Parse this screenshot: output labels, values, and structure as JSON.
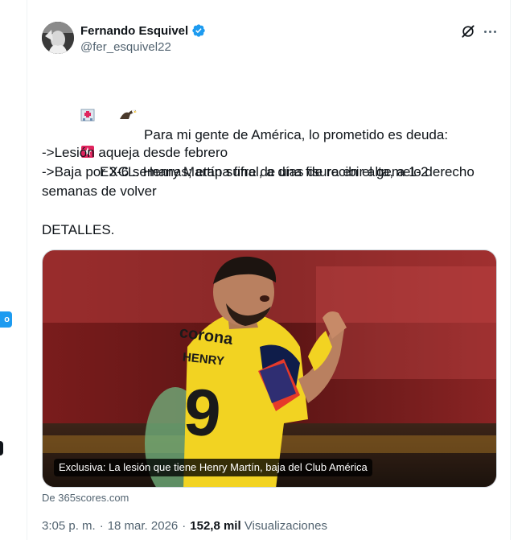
{
  "author": {
    "display_name": "Fernando Esquivel",
    "handle": "@fer_esquivel22",
    "verified": true
  },
  "colors": {
    "accent": "#1d9bf0",
    "text": "#0f1419",
    "secondary": "#536471",
    "jersey_yellow": "#f2d322"
  },
  "edge": {
    "badge_text": "o"
  },
  "tweet": {
    "line1": "Para mi gente de América, lo prometido es deuda:",
    "line2": "EXCL. Henry Martín sufre de una fisura en el gemelo derecho",
    "line3": "->Lesión aqueja desde febrero",
    "line4": "->Baja por 3-6 semanas; etapa final, a días de recibir alta, a 1-2",
    "line5": "semanas de volver",
    "line6": "DETALLES."
  },
  "card": {
    "caption": "Exclusiva: La lesión que tiene Henry Martín, baja del Club América",
    "jersey_sponsor": "corona",
    "jersey_name": "HENRY",
    "jersey_number": "9",
    "source": "De 365scores.com"
  },
  "meta": {
    "time": "3:05 p. m.",
    "sep1": "·",
    "date": "18 mar. 2026",
    "sep2": "·",
    "views_count": "152,8 mil",
    "views_label": "Visualizaciones"
  }
}
